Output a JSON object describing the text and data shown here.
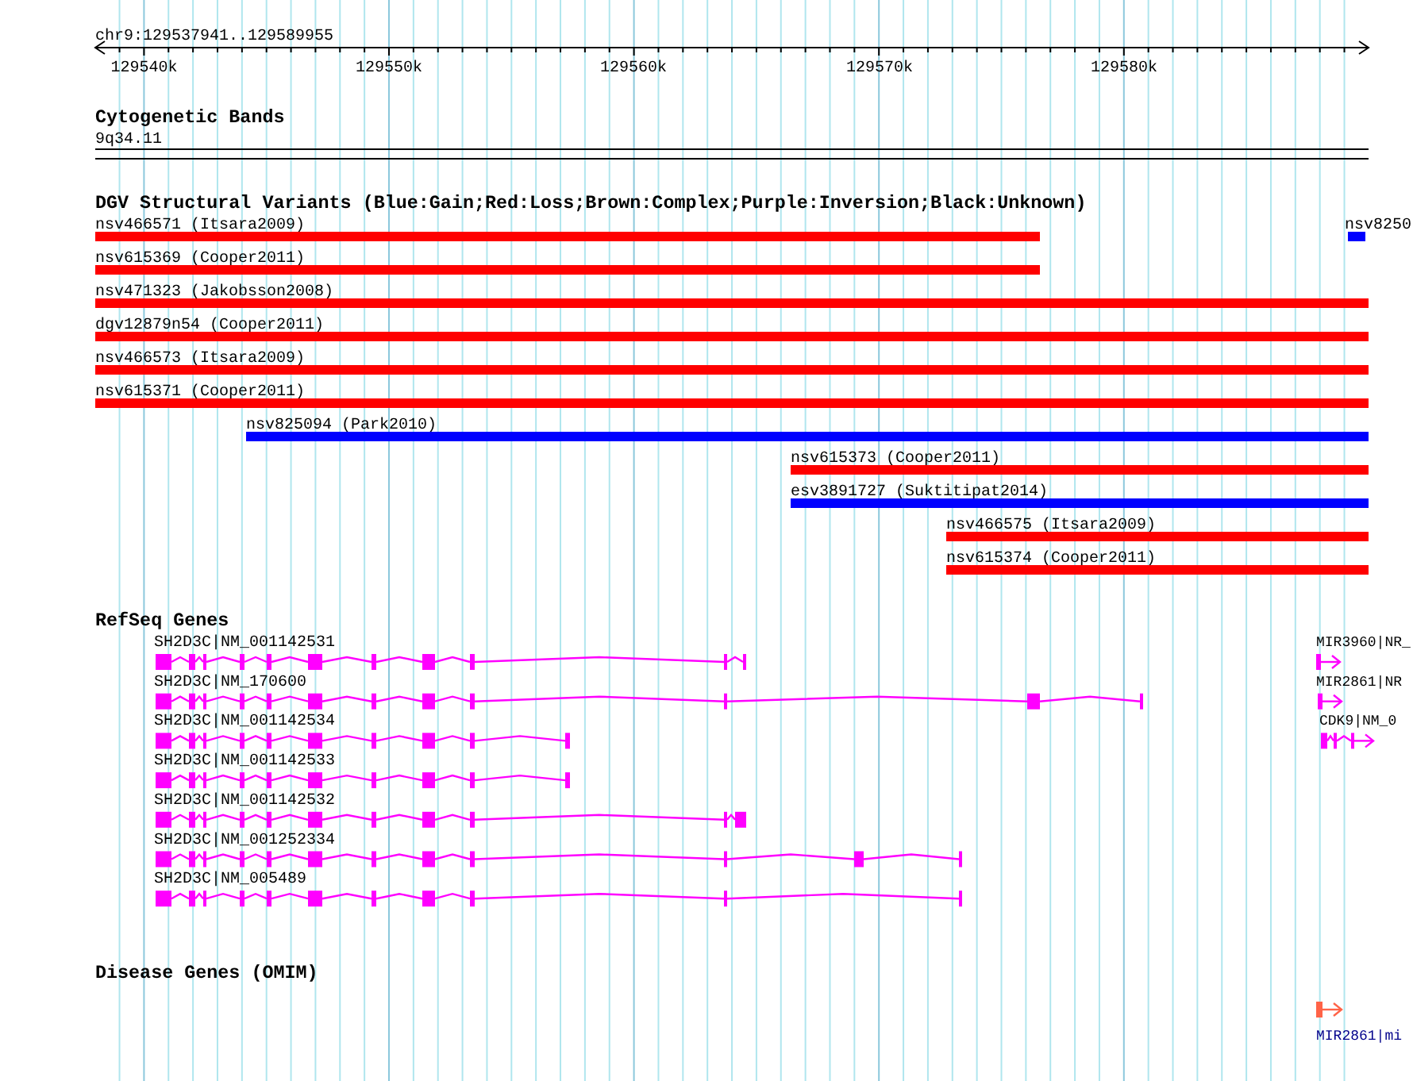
{
  "ruler": {
    "location": "chr9:129537941..129589955",
    "ticks": [
      "129540k",
      "129550k",
      "129560k",
      "129570k",
      "129580k"
    ]
  },
  "tracks": [
    {
      "kind": "bands",
      "title": "Cytogenetic Bands",
      "bands": [
        "9q34.11"
      ]
    },
    {
      "kind": "variants",
      "title": "DGV Structural Variants (Blue:Gain;Red:Loss;Brown:Complex;Purple:Inversion;Black:Unknown)",
      "features": [
        {
          "label": "nsv466571 (Itsara2009)",
          "color": "#ff0000"
        },
        {
          "label": "nsv8250",
          "color": "#0000ff"
        },
        {
          "label": "nsv615369 (Cooper2011)",
          "color": "#ff0000"
        },
        {
          "label": "nsv471323 (Jakobsson2008)",
          "color": "#ff0000"
        },
        {
          "label": "dgv12879n54 (Cooper2011)",
          "color": "#ff0000"
        },
        {
          "label": "nsv466573 (Itsara2009)",
          "color": "#ff0000"
        },
        {
          "label": "nsv615371 (Cooper2011)",
          "color": "#ff0000"
        },
        {
          "label": "nsv825094 (Park2010)",
          "color": "#0000ff"
        },
        {
          "label": "nsv615373 (Cooper2011)",
          "color": "#ff0000"
        },
        {
          "label": "esv3891727 (Suktitipat2014)",
          "color": "#0000ff"
        },
        {
          "label": "nsv466575 (Itsara2009)",
          "color": "#ff0000"
        },
        {
          "label": "nsv615374 (Cooper2011)",
          "color": "#ff0000"
        }
      ]
    },
    {
      "kind": "genes",
      "title": "RefSeq Genes",
      "features": [
        {
          "label": "SH2D3C|NM_001142531"
        },
        {
          "label": "MIR3960|NR_"
        },
        {
          "label": "SH2D3C|NM_170600"
        },
        {
          "label": "MIR2861|NR"
        },
        {
          "label": "SH2D3C|NM_001142534"
        },
        {
          "label": "CDK9|NM_0"
        },
        {
          "label": "SH2D3C|NM_001142533"
        },
        {
          "label": "SH2D3C|NM_001142532"
        },
        {
          "label": "SH2D3C|NM_001252334"
        },
        {
          "label": "SH2D3C|NM_005489"
        }
      ]
    },
    {
      "kind": "disease",
      "title": "Disease Genes (OMIM)",
      "features": [
        {
          "label": "MIR2861|mi"
        }
      ]
    }
  ]
}
